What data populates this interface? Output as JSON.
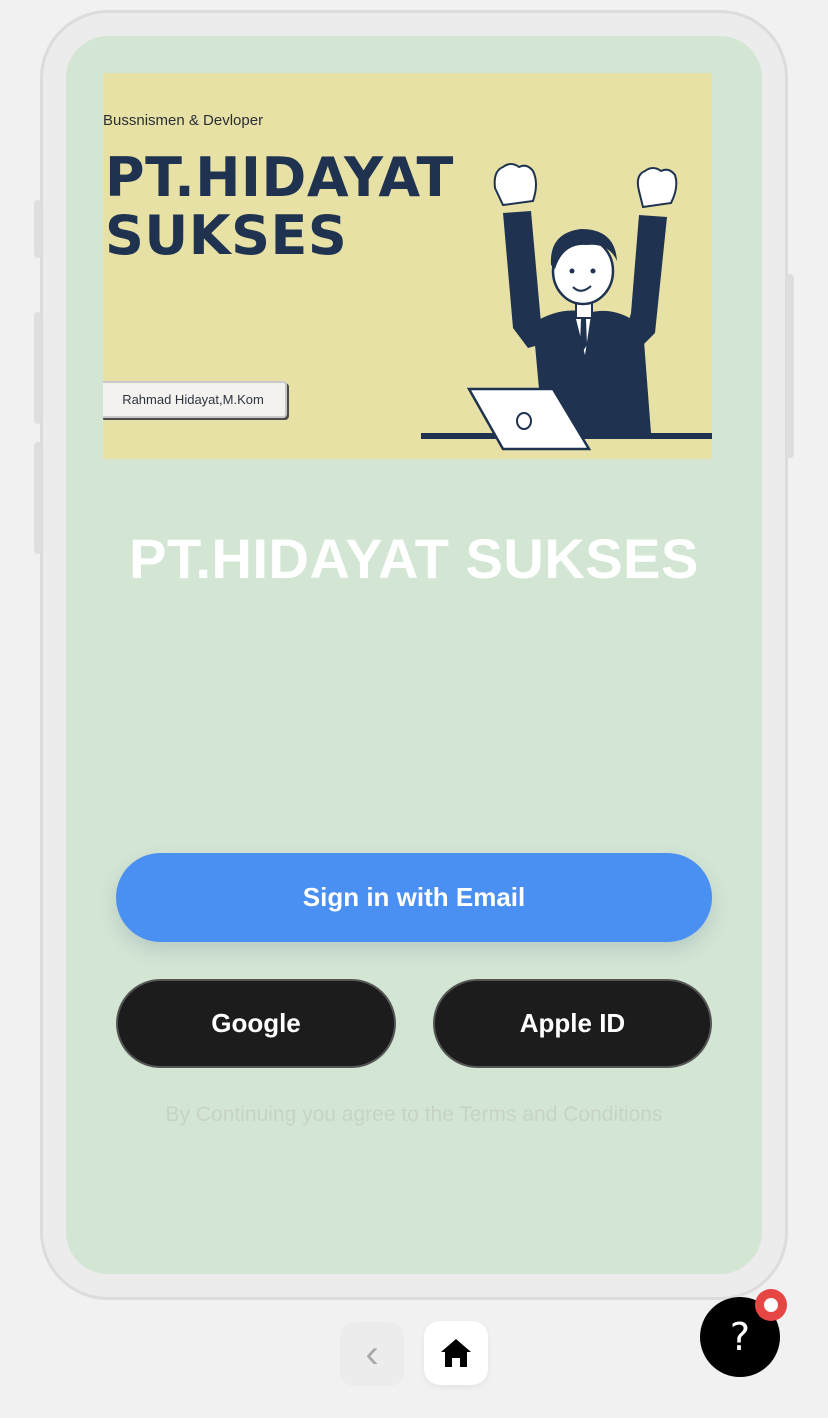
{
  "banner": {
    "subtitle": "Bussnismen & Devloper",
    "title_line1": "PT.HIDAYAT",
    "title_line2": "SUKSES",
    "author_tag": "Rahmad Hidayat,M.Kom",
    "illustration_icon": "businessman-laptop-illustration"
  },
  "app_title": "PT.HIDAYAT SUKSES",
  "buttons": {
    "email": "Sign in with Email",
    "google": "Google",
    "apple": "Apple ID"
  },
  "terms": "By Continuing you agree to the Terms and Conditions",
  "nav": {
    "back_icon": "‹",
    "home_icon": "home-icon"
  },
  "help": {
    "label": "?",
    "badge_icon": "notification-dot"
  },
  "colors": {
    "screen_bg": "#d3e5d3",
    "banner_bg": "#e7e1a6",
    "primary": "#4a8ff2",
    "dark_button": "#1c1c1c",
    "badge": "#e74744"
  }
}
